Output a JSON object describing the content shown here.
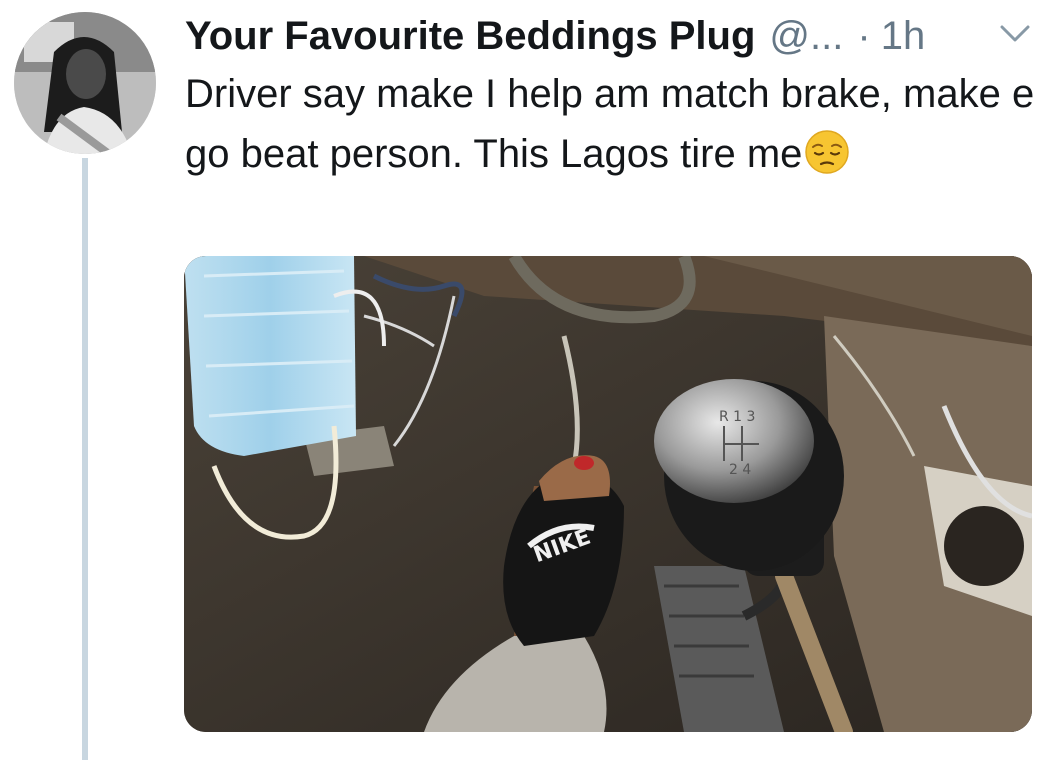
{
  "tweet": {
    "display_name": "Your Favourite Beddings Plug",
    "handle": "@...",
    "separator": "·",
    "time": "1h",
    "text": "Driver say make I help am match brake, make e go beat person. This Lagos tire me",
    "emoji": "pensive-face-emoji"
  },
  "media": {
    "description_icon": "photo",
    "slipper_logo": "NIKE",
    "shift_pattern_top": "R 1 3",
    "shift_pattern_bottom": "2 4"
  },
  "colors": {
    "secondary_text": "#657786",
    "primary_text": "#14171a",
    "thread_line": "#c8d6e0"
  }
}
